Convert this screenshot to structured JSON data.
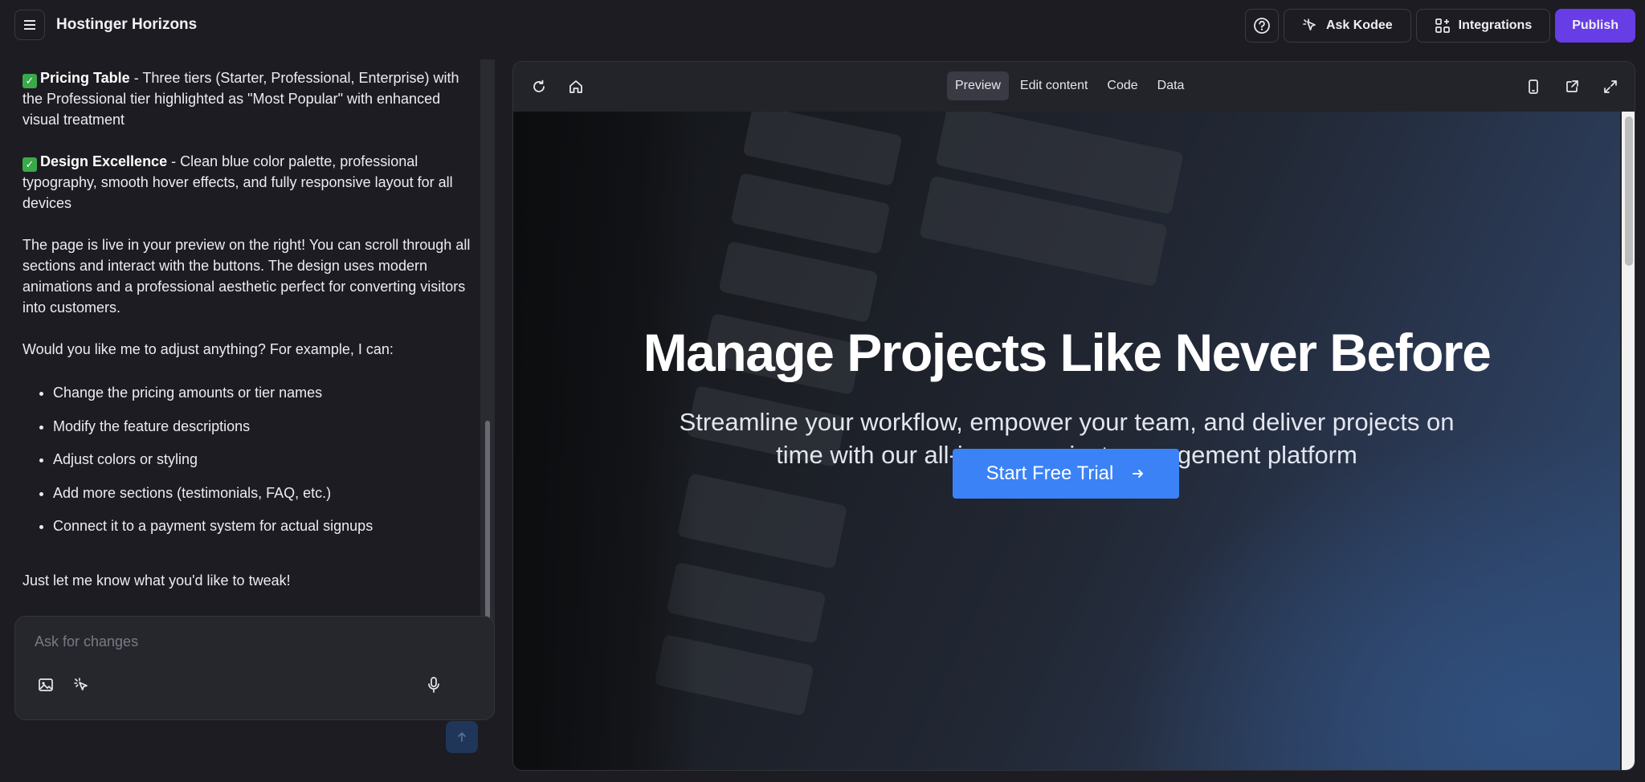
{
  "app": {
    "title": "Hostinger Horizons"
  },
  "topbar": {
    "ask_kodee": "Ask Kodee",
    "integrations": "Integrations",
    "publish": "Publish"
  },
  "chat": {
    "pricing_heading": "Pricing Table",
    "pricing_text": " - Three tiers (Starter, Professional, Enterprise) with the Professional tier highlighted as \"Most Popular\" with enhanced visual treatment",
    "design_heading": "Design Excellence",
    "design_text": " - Clean blue color palette, professional typography, smooth hover effects, and fully responsive layout for all devices",
    "live_text": "The page is live in your preview on the right! You can scroll through all sections and interact with the buttons. The design uses modern animations and a professional aesthetic perfect for converting visitors into customers.",
    "question": "Would you like me to adjust anything? For example, I can:",
    "options": [
      "Change the pricing amounts or tier names",
      "Modify the feature descriptions",
      "Adjust colors or styling",
      "Add more sections (testimonials, FAQ, etc.)",
      "Connect it to a payment system for actual signups"
    ],
    "closing": "Just let me know what you'd like to tweak!"
  },
  "input": {
    "placeholder": "Ask for changes"
  },
  "preview": {
    "tabs": [
      "Preview",
      "Edit content",
      "Code",
      "Data"
    ],
    "active_tab": "Preview",
    "hero": {
      "title": "Manage Projects Like Never Before",
      "subtitle": "Streamline your workflow, empower your team, and deliver projects on time with our all-in-one project management platform",
      "cta": "Start Free Trial"
    }
  },
  "colors": {
    "publish": "#673de6",
    "cta": "#3b82f6",
    "background": "#1c1c22"
  }
}
